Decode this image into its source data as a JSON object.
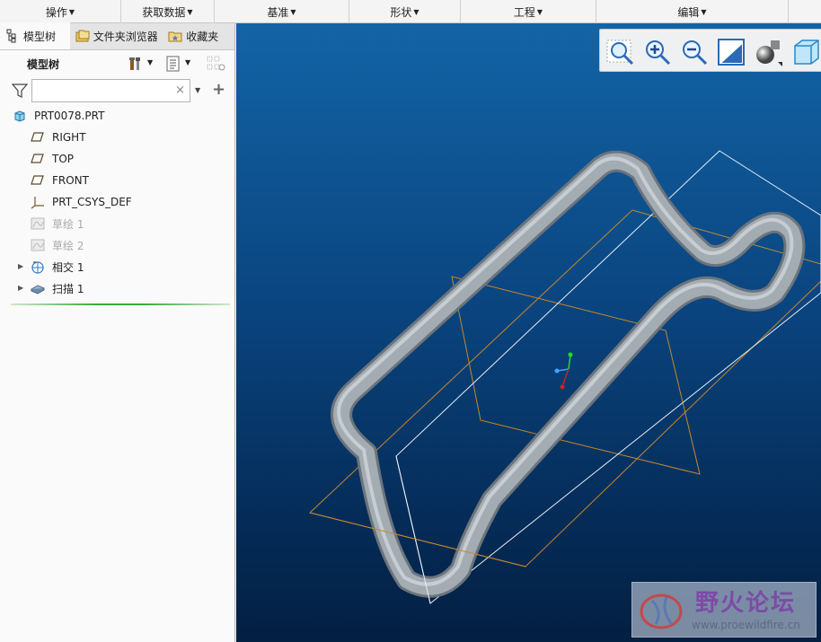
{
  "ribbon": {
    "groups": [
      {
        "label": "操作"
      },
      {
        "label": "获取数据"
      },
      {
        "label": "基准"
      },
      {
        "label": "形状"
      },
      {
        "label": "工程"
      },
      {
        "label": "编辑"
      }
    ]
  },
  "left_panel": {
    "tabs": [
      {
        "label": "模型树",
        "icon": "model-tree-icon"
      },
      {
        "label": "文件夹浏览器",
        "icon": "folder-browser-icon"
      },
      {
        "label": "收藏夹",
        "icon": "favorites-icon"
      }
    ],
    "tree_title": "模型树",
    "search_placeholder": "",
    "search_value": "",
    "clear_glyph": "×",
    "add_glyph": "+",
    "tree": [
      {
        "label": "PRT0078.PRT",
        "icon": "part-icon",
        "dim": false,
        "expandable": false
      },
      {
        "label": "RIGHT",
        "icon": "datum-plane-icon",
        "dim": false,
        "expandable": false
      },
      {
        "label": "TOP",
        "icon": "datum-plane-icon",
        "dim": false,
        "expandable": false
      },
      {
        "label": "FRONT",
        "icon": "datum-plane-icon",
        "dim": false,
        "expandable": false
      },
      {
        "label": "PRT_CSYS_DEF",
        "icon": "coordinate-system-icon",
        "dim": false,
        "expandable": false
      },
      {
        "label": "草绘 1",
        "icon": "sketch-icon",
        "dim": true,
        "expandable": false
      },
      {
        "label": "草绘 2",
        "icon": "sketch-icon",
        "dim": true,
        "expandable": false
      },
      {
        "label": "相交 1",
        "icon": "intersect-icon",
        "dim": false,
        "expandable": true
      },
      {
        "label": "扫描 1",
        "icon": "sweep-icon",
        "dim": false,
        "expandable": true
      }
    ]
  },
  "view_toolbar": {
    "tools": [
      "refit-icon",
      "zoom-in-icon",
      "zoom-out-icon",
      "repaint-icon",
      "display-style-icon",
      "saved-views-icon"
    ]
  },
  "watermark": {
    "cn": "野火论坛",
    "url": "www.proewildfire.cn"
  },
  "colors": {
    "viewport_top": "#1364a6",
    "viewport_bottom": "#031f42",
    "tube": "#9aa2aa",
    "datum_orange": "#c8882a",
    "datum_white": "#e8eef6"
  }
}
